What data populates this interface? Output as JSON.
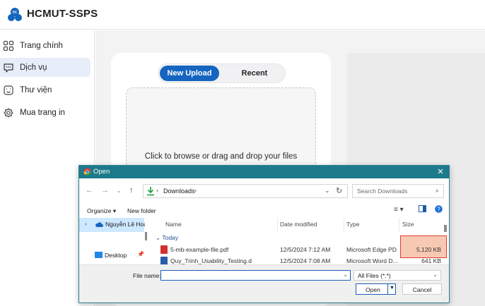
{
  "app": {
    "title": "HCMUT-SSPS"
  },
  "sidebar": {
    "items": [
      {
        "label": "Trang chính",
        "icon": "grid-icon"
      },
      {
        "label": "Dịch vụ",
        "icon": "chat-icon",
        "active": true
      },
      {
        "label": "Thư viện",
        "icon": "library-icon"
      },
      {
        "label": "Mua trang in",
        "icon": "gear-icon"
      }
    ]
  },
  "upload": {
    "tabs": {
      "new_upload": "New Upload",
      "recent": "Recent"
    },
    "drop_text": "Click to browse or drag and drop your files"
  },
  "dialog": {
    "title": "Open",
    "address": {
      "crumb": "Downloads",
      "separator": "›"
    },
    "search_placeholder": "Search Downloads",
    "organize": "Organize ▾",
    "new_folder": "New folder",
    "nav": {
      "onedrive": "Nguyễn Lê Hoàng",
      "desktop": "Desktop"
    },
    "columns": {
      "name": "Name",
      "date": "Date modified",
      "type": "Type",
      "size": "Size"
    },
    "group": "Today",
    "files": [
      {
        "name": "5-mb-example-file.pdf",
        "date": "12/5/2024 7:12 AM",
        "type": "Microsoft Edge PD...",
        "size": "5,120 KB"
      },
      {
        "name": "Quy_Trinh_Usability_Testing.docx",
        "date": "12/5/2024 7:08 AM",
        "type": "Microsoft Word D...",
        "size": "641 KB"
      }
    ],
    "file_name_label": "File name:",
    "file_name_value": "",
    "filter": "All Files (*.*)",
    "open": "Open",
    "cancel": "Cancel"
  },
  "colors": {
    "brand": "#1565c0",
    "dialog_title": "#1d7a8a",
    "highlight": "#e03c31"
  }
}
